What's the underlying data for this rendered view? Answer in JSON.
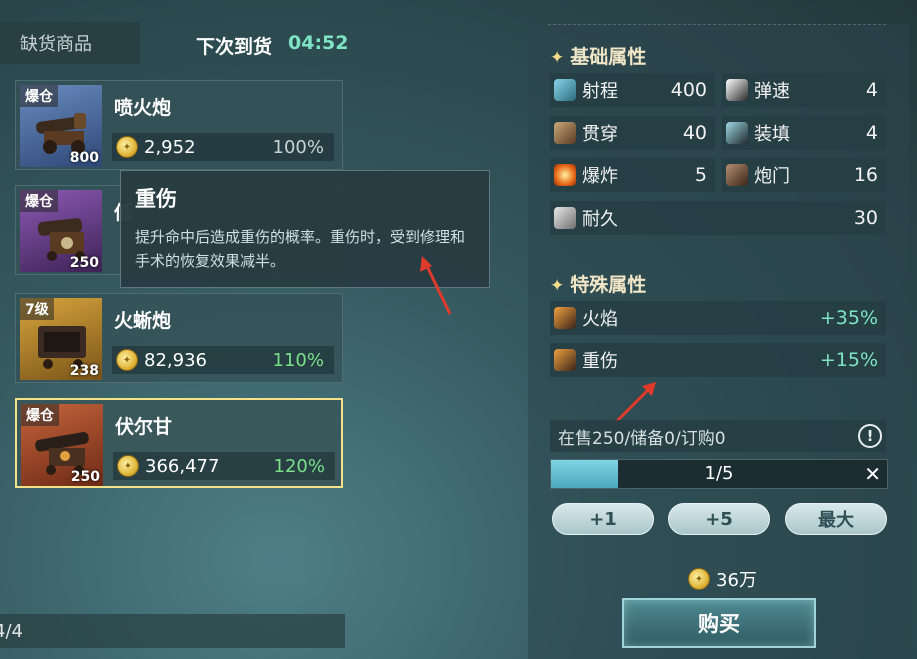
{
  "header": {
    "tab_label": "缺货商品",
    "restock_label": "下次到货",
    "restock_time": "04:52"
  },
  "items": [
    {
      "tag": "爆仓",
      "count": "800",
      "name": "喷火炮",
      "price": "2,952",
      "percent": "100%",
      "rarity_color": "#6a8cc0"
    },
    {
      "tag": "爆仓",
      "count": "250",
      "name": "低",
      "price": "",
      "percent": "",
      "rarity_color": "#8c5ab4"
    },
    {
      "tag": "7级",
      "count": "238",
      "name": "火蜥炮",
      "price": "82,936",
      "percent": "110%",
      "rarity_color": "#d7a53d"
    },
    {
      "tag": "爆仓",
      "count": "250",
      "name": "伏尔甘",
      "price": "366,477",
      "percent": "120%",
      "rarity_color": "#c5643b"
    }
  ],
  "tooltip": {
    "title": "重伤",
    "description": "提升命中后造成重伤的概率。重伤时，受到修理和手术的恢复效果减半。"
  },
  "left_footer": {
    "page_text": "4/4"
  },
  "basic_attributes": {
    "title": "基础属性",
    "stats": [
      {
        "label": "射程",
        "value": "400",
        "icon": "range-icon"
      },
      {
        "label": "弹速",
        "value": "4",
        "icon": "bullet-speed-icon"
      },
      {
        "label": "贯穿",
        "value": "40",
        "icon": "pierce-icon"
      },
      {
        "label": "装填",
        "value": "4",
        "icon": "reload-icon"
      },
      {
        "label": "爆炸",
        "value": "5",
        "icon": "explosion-icon"
      },
      {
        "label": "炮门",
        "value": "16",
        "icon": "gun-port-icon"
      },
      {
        "label": "耐久",
        "value": "30",
        "icon": "durability-icon"
      }
    ]
  },
  "special_attributes": {
    "title": "特殊属性",
    "stats": [
      {
        "label": "火焰",
        "value": "+35%",
        "icon": "fire-icon"
      },
      {
        "label": "重伤",
        "value": "+15%",
        "icon": "heavy-wound-icon"
      }
    ]
  },
  "stock": {
    "text": "在售250/储备0/订购0",
    "info_symbol": "!"
  },
  "quantity": {
    "text": "1/5",
    "fill_fraction": 0.2,
    "close_symbol": "✕"
  },
  "buttons": {
    "plus1": "+1",
    "plus5": "+5",
    "max": "最大",
    "buy": "购买"
  },
  "total": {
    "amount": "36万"
  },
  "colors": {
    "accent_green": "#7fe4c3",
    "percent_green": "#7be08a",
    "selected_border": "#f3e28a",
    "arrow_red": "#e03a2c"
  }
}
